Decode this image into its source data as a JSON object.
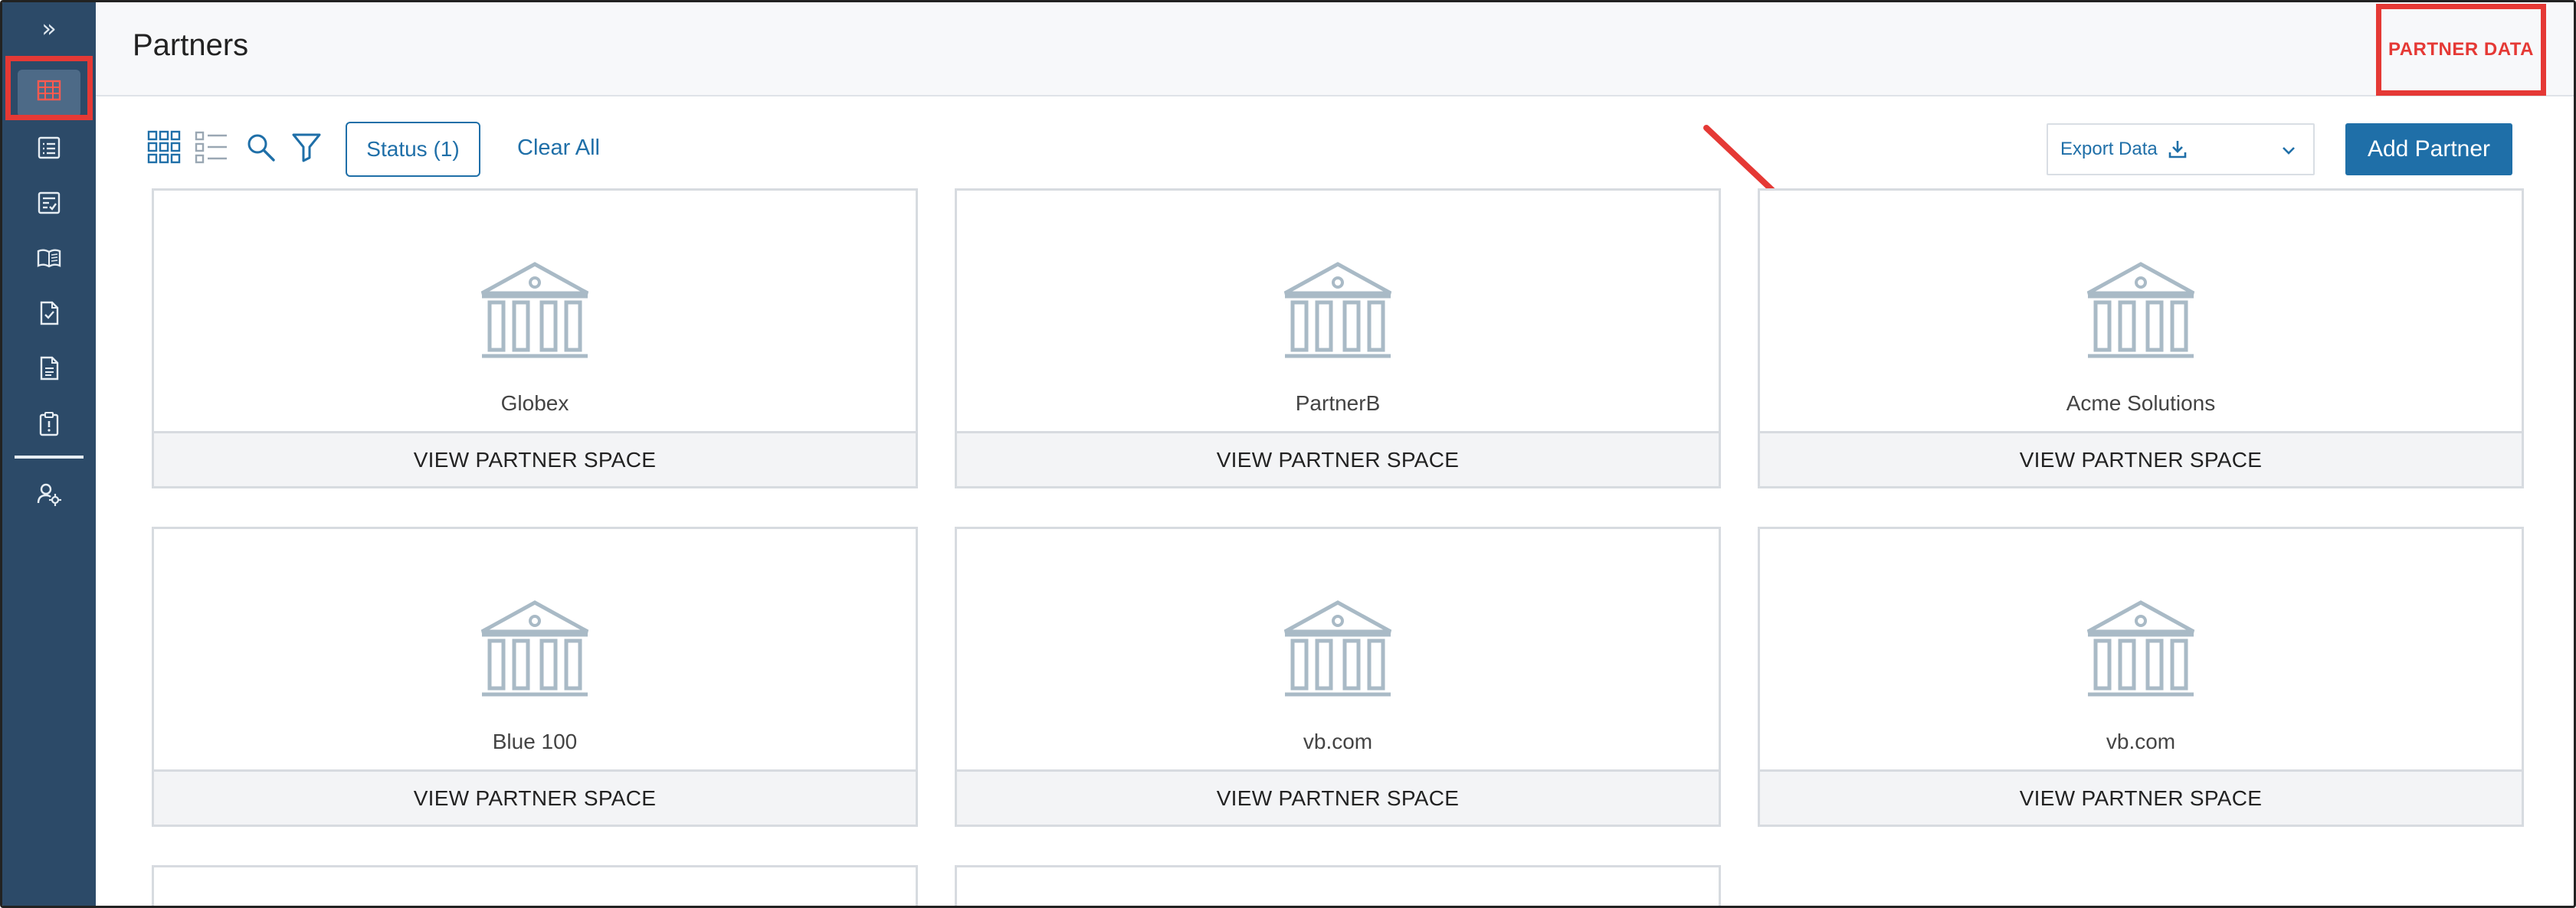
{
  "header": {
    "title": "Partners",
    "partner_data_label": "PARTNER DATA"
  },
  "sidebar": {
    "toggle_glyph": "»",
    "items": [
      {
        "icon": "building-icon",
        "active": true
      },
      {
        "icon": "list-icon"
      },
      {
        "icon": "checklist-icon"
      },
      {
        "icon": "book-icon"
      },
      {
        "icon": "document-check-icon"
      },
      {
        "icon": "document-icon"
      },
      {
        "icon": "clipboard-alert-icon"
      },
      {
        "icon": "user-settings-icon"
      }
    ]
  },
  "toolbar": {
    "status_filter_label": "Status (1)",
    "clear_all_label": "Clear All",
    "export_label": "Export Data",
    "add_partner_label": "Add Partner"
  },
  "cards": [
    {
      "name": "Globex",
      "action": "VIEW PARTNER SPACE"
    },
    {
      "name": "PartnerB",
      "action": "VIEW PARTNER SPACE"
    },
    {
      "name": "Acme Solutions",
      "action": "VIEW PARTNER SPACE"
    },
    {
      "name": "Blue 100",
      "action": "VIEW PARTNER SPACE"
    },
    {
      "name": "vb.com",
      "action": "VIEW PARTNER SPACE"
    },
    {
      "name": "vb.com",
      "action": "VIEW PARTNER SPACE"
    }
  ],
  "colors": {
    "sidebar_bg": "#2c4a68",
    "accent_blue": "#1f6fa8",
    "annotation_red": "#e53935",
    "bank_icon": "#a9bac6"
  }
}
